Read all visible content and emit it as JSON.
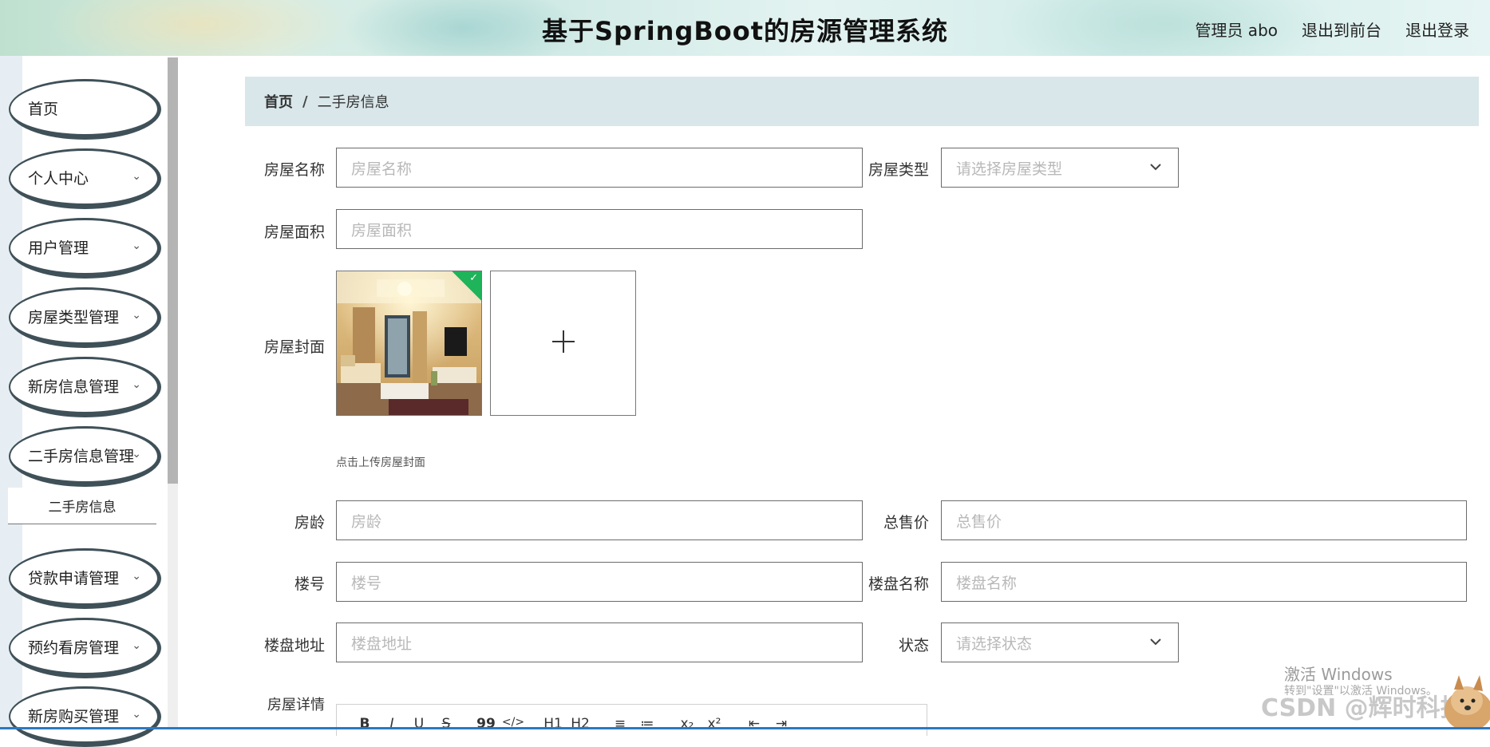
{
  "header": {
    "title": "基于SpringBoot的房源管理系统",
    "nav": [
      "管理员 abo",
      "退出到前台",
      "退出登录"
    ]
  },
  "sidebar": {
    "items": [
      {
        "label": "首页",
        "has_chevron": false
      },
      {
        "label": "个人中心",
        "has_chevron": true
      },
      {
        "label": "用户管理",
        "has_chevron": true
      },
      {
        "label": "房屋类型管理",
        "has_chevron": true
      },
      {
        "label": "新房信息管理",
        "has_chevron": true
      },
      {
        "label": "二手房信息管理",
        "has_chevron": true
      },
      {
        "label": "贷款申请管理",
        "has_chevron": true
      },
      {
        "label": "预约看房管理",
        "has_chevron": true
      },
      {
        "label": "新房购买管理",
        "has_chevron": true
      }
    ],
    "active_sub_item": "二手房信息",
    "chevron": "⌄"
  },
  "breadcrumb": {
    "home": "首页",
    "separator": "/",
    "current": "二手房信息"
  },
  "form": {
    "name": {
      "label": "房屋名称",
      "placeholder": "房屋名称"
    },
    "type": {
      "label": "房屋类型",
      "placeholder": "请选择房屋类型"
    },
    "area": {
      "label": "房屋面积",
      "placeholder": "房屋面积"
    },
    "cover": {
      "label": "房屋封面",
      "hint": "点击上传房屋封面",
      "add_symbol": "+"
    },
    "age": {
      "label": "房龄",
      "placeholder": "房龄"
    },
    "price": {
      "label": "总售价",
      "placeholder": "总售价"
    },
    "building_no": {
      "label": "楼号",
      "placeholder": "楼号"
    },
    "estate_name": {
      "label": "楼盘名称",
      "placeholder": "楼盘名称"
    },
    "estate_address": {
      "label": "楼盘地址",
      "placeholder": "楼盘地址"
    },
    "status": {
      "label": "状态",
      "placeholder": "请选择状态"
    },
    "details": {
      "label": "房屋详情"
    }
  },
  "editor_toolbar": [
    "B",
    "I",
    "U",
    "S",
    "99",
    "</>",
    "H1",
    "H2",
    "≡",
    "≔",
    "x₂",
    "x²",
    "⇤",
    "⇥"
  ],
  "watermark": {
    "line1": "激活 Windows",
    "line2": "转到\"设置\"以激活 Windows。",
    "csdn": "CSDN @辉时科技"
  },
  "colors": {
    "breadcrumb_bg": "#d9e7ea",
    "menu_border": "#3f5058",
    "check_badge": "#1fb35a"
  },
  "icons": {
    "upload_check": "check-icon",
    "upload_add": "plus-icon",
    "select": "chevron-down-icon"
  }
}
